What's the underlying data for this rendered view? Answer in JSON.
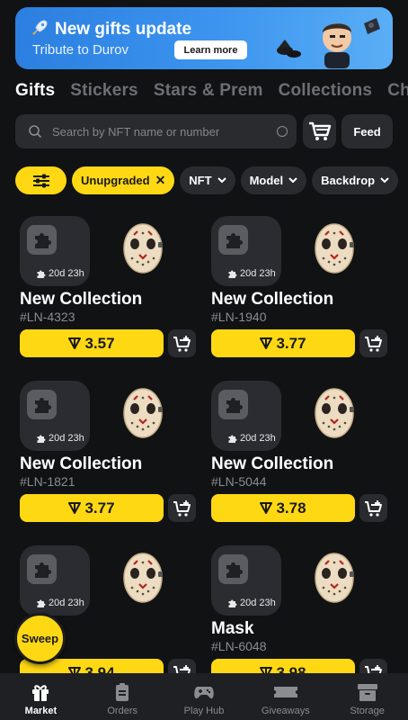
{
  "banner": {
    "title": "New gifts update",
    "subtitle": "Tribute to Durov",
    "button": "Learn more",
    "icon": "rocket-icon"
  },
  "tabs": [
    {
      "label": "Gifts",
      "active": true
    },
    {
      "label": "Stickers",
      "active": false
    },
    {
      "label": "Stars & Prem",
      "active": false
    },
    {
      "label": "Collections",
      "active": false
    },
    {
      "label": "Ch",
      "active": false
    }
  ],
  "search": {
    "placeholder": "Search by NFT name or number",
    "feed_label": "Feed"
  },
  "filters": {
    "active_chip": "Unupgraded",
    "chips": [
      "NFT",
      "Model",
      "Backdrop"
    ]
  },
  "cards": [
    {
      "name": "New Collection",
      "id": "#LN-4323",
      "price": "3.57",
      "timer": "20d 23h"
    },
    {
      "name": "New Collection",
      "id": "#LN-1940",
      "price": "3.77",
      "timer": "20d 23h"
    },
    {
      "name": "New Collection",
      "id": "#LN-1821",
      "price": "3.77",
      "timer": "20d 23h"
    },
    {
      "name": "New Collection",
      "id": "#LN-5044",
      "price": "3.78",
      "timer": "20d 23h"
    },
    {
      "name": "",
      "id": "38",
      "price": "3.94",
      "timer": "20d 23h"
    },
    {
      "name": "Mask",
      "id": "#LN-6048",
      "price": "3.98",
      "timer": "20d 23h"
    }
  ],
  "sweep_label": "Sweep",
  "nav": [
    {
      "label": "Market",
      "icon": "gift-icon",
      "active": true
    },
    {
      "label": "Orders",
      "icon": "orders-icon",
      "active": false
    },
    {
      "label": "Play Hub",
      "icon": "gamepad-icon",
      "active": false
    },
    {
      "label": "Giveaways",
      "icon": "ticket-icon",
      "active": false
    },
    {
      "label": "Storage",
      "icon": "storage-icon",
      "active": false
    }
  ],
  "colors": {
    "accent": "#ffd814",
    "background": "#111214",
    "surface": "#2a2b2f",
    "banner": "#3d95ef"
  }
}
